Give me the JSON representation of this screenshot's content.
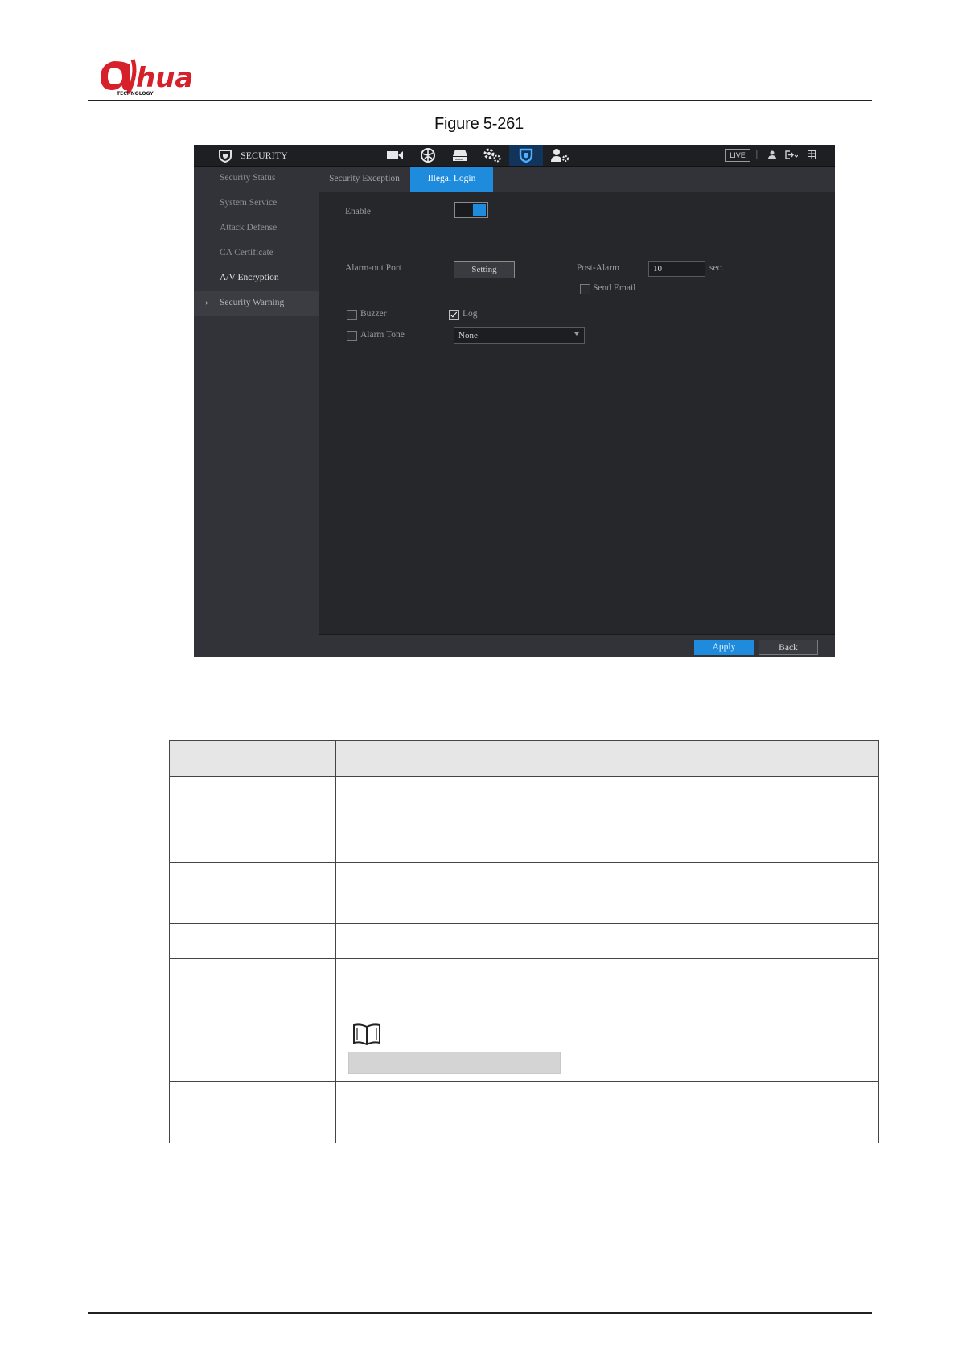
{
  "figure_caption": "Figure 5-261",
  "screenshot": {
    "topbar": {
      "title": "SECURITY",
      "live_label": "LIVE",
      "icons": [
        "camera-icon",
        "network-icon",
        "storage-icon",
        "settings-icon",
        "security-icon",
        "account-icon"
      ],
      "active_icon": "security-icon"
    },
    "sidebar": {
      "items": [
        {
          "label": "Security Status"
        },
        {
          "label": "System Service"
        },
        {
          "label": "Attack Defense"
        },
        {
          "label": "CA Certificate"
        },
        {
          "label": "A/V Encryption"
        },
        {
          "label": "Security Warning"
        }
      ],
      "selected": "Security Warning"
    },
    "tabs": [
      {
        "label": "Security Exception"
      },
      {
        "label": "Illegal Login"
      }
    ],
    "active_tab": "Illegal Login",
    "form": {
      "enable_label": "Enable",
      "enable_on": true,
      "alarm_out_label": "Alarm-out Port",
      "setting_button": "Setting",
      "post_alarm_label": "Post-Alarm",
      "post_alarm_value": "10",
      "post_alarm_unit": "sec.",
      "send_email_label": "Send Email",
      "send_email_checked": false,
      "buzzer_label": "Buzzer",
      "buzzer_checked": false,
      "log_label": "Log",
      "log_checked": true,
      "alarm_tone_label": "Alarm Tone",
      "alarm_tone_checked": false,
      "alarm_tone_value": "None"
    },
    "footer": {
      "apply": "Apply",
      "back": "Back"
    }
  },
  "colors": {
    "accent": "#1e8bdc",
    "panel": "#26272b",
    "sidebar": "#323338"
  }
}
